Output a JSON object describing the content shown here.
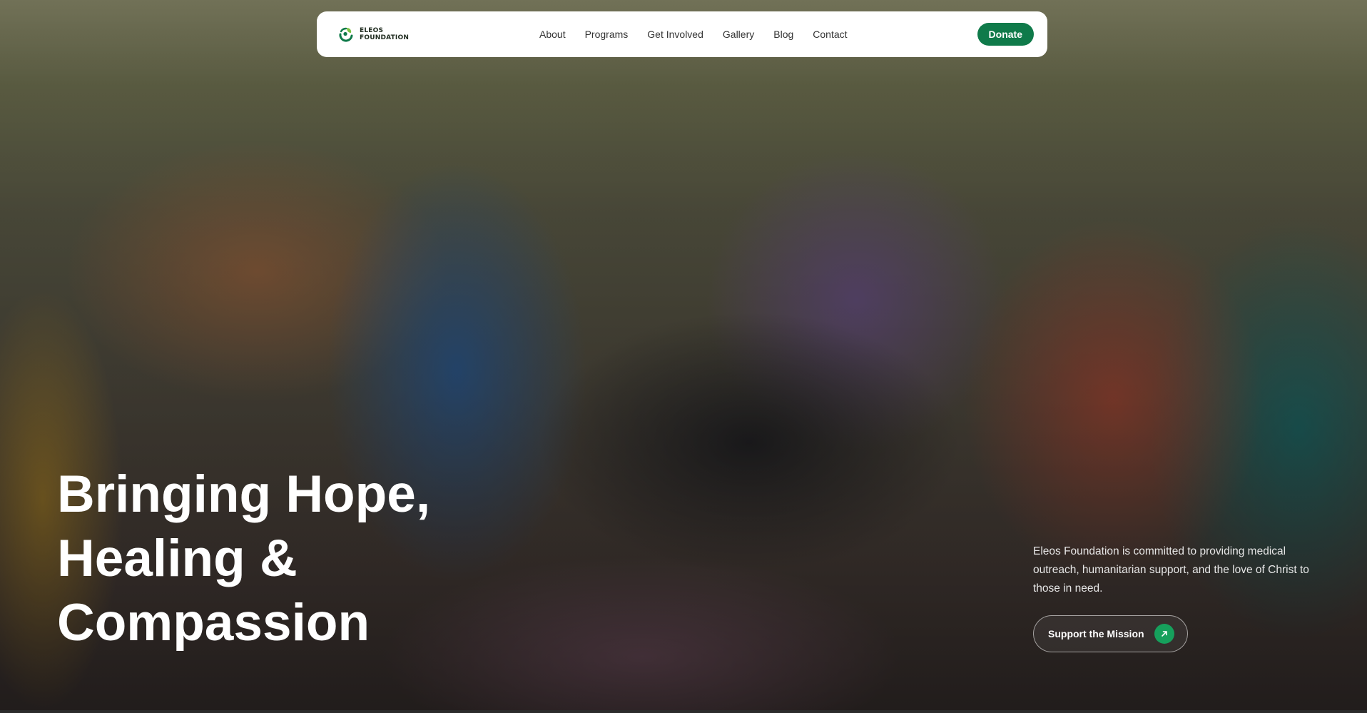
{
  "brand": {
    "name_line1": "ELEOS",
    "name_line2": "FOUNDATION",
    "accent": "#0f7a4a",
    "logo_icon": "leaf-person-logo-icon"
  },
  "nav": {
    "items": [
      {
        "label": "About"
      },
      {
        "label": "Programs"
      },
      {
        "label": "Get Involved"
      },
      {
        "label": "Gallery"
      },
      {
        "label": "Blog"
      },
      {
        "label": "Contact"
      }
    ],
    "donate_label": "Donate"
  },
  "hero": {
    "title_lines": [
      "Bringing Hope,",
      "Healing &",
      "Compassion"
    ],
    "description": "Eleos Foundation is committed to providing medical outreach, humanitarian support, and the love of Christ to those in need.",
    "cta_label": "Support the Mission",
    "cta_icon": "arrow-up-right-icon",
    "cta_icon_color": "#16a05c"
  }
}
